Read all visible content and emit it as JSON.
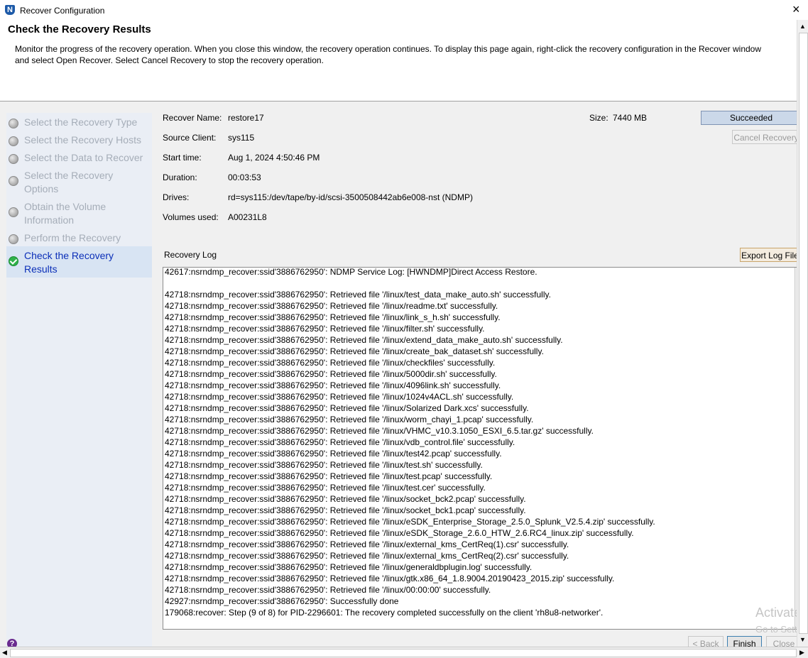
{
  "window": {
    "title": "Recover Configuration",
    "icon_letter": "N",
    "close_glyph": "×"
  },
  "header": {
    "heading": "Check the Recovery Results",
    "description": "Monitor the progress of the recovery operation. When you close this window, the recovery operation continues. To display this page again, right-click the recovery configuration in the Recover window and select Open Recover. Select Cancel Recovery to stop the recovery operation."
  },
  "steps": [
    {
      "label": "Select the Recovery Type",
      "state": "done"
    },
    {
      "label": "Select the Recovery Hosts",
      "state": "done"
    },
    {
      "label": "Select the Data to Recover",
      "state": "done"
    },
    {
      "label": "Select the Recovery Options",
      "state": "done"
    },
    {
      "label": "Obtain the Volume Information",
      "state": "done"
    },
    {
      "label": "Perform the Recovery",
      "state": "done"
    },
    {
      "label": "Check the Recovery Results",
      "state": "active"
    }
  ],
  "summary": {
    "recover_name_label": "Recover Name:",
    "recover_name": "restore17",
    "source_client_label": "Source Client:",
    "source_client": "sys115",
    "start_time_label": "Start time:",
    "start_time": "Aug 1, 2024 4:50:46 PM",
    "duration_label": "Duration:",
    "duration": "00:03:53",
    "drives_label": "Drives:",
    "drives": "rd=sys115:/dev/tape/by-id/scsi-3500508442ab6e008-nst (NDMP)",
    "volumes_label": "Volumes used:",
    "volumes": "A00231L8",
    "size_label": "Size:",
    "size": "7440 MB",
    "status": "Succeeded"
  },
  "buttons": {
    "cancel_recovery": "Cancel Recovery",
    "export_log": "Export Log File",
    "back": "< Back",
    "finish": "Finish",
    "close": "Close"
  },
  "log": {
    "label": "Recovery Log",
    "lines": [
      "42617:nsrndmp_recover:ssid'3886762950': NDMP Service Log: [HWNDMP]Direct Access Restore.",
      "",
      "42718:nsrndmp_recover:ssid'3886762950': Retrieved file '/linux/test_data_make_auto.sh' successfully.",
      "42718:nsrndmp_recover:ssid'3886762950': Retrieved file '/linux/readme.txt' successfully.",
      "42718:nsrndmp_recover:ssid'3886762950': Retrieved file '/linux/link_s_h.sh' successfully.",
      "42718:nsrndmp_recover:ssid'3886762950': Retrieved file '/linux/filter.sh' successfully.",
      "42718:nsrndmp_recover:ssid'3886762950': Retrieved file '/linux/extend_data_make_auto.sh' successfully.",
      "42718:nsrndmp_recover:ssid'3886762950': Retrieved file '/linux/create_bak_dataset.sh' successfully.",
      "42718:nsrndmp_recover:ssid'3886762950': Retrieved file '/linux/checkfiles' successfully.",
      "42718:nsrndmp_recover:ssid'3886762950': Retrieved file '/linux/5000dir.sh' successfully.",
      "42718:nsrndmp_recover:ssid'3886762950': Retrieved file '/linux/4096link.sh' successfully.",
      "42718:nsrndmp_recover:ssid'3886762950': Retrieved file '/linux/1024v4ACL.sh' successfully.",
      "42718:nsrndmp_recover:ssid'3886762950': Retrieved file '/linux/Solarized Dark.xcs' successfully.",
      "42718:nsrndmp_recover:ssid'3886762950': Retrieved file '/linux/worm_chayi_1.pcap' successfully.",
      "42718:nsrndmp_recover:ssid'3886762950': Retrieved file '/linux/VHMC_v10.3.1050_ESXI_6.5.tar.gz' successfully.",
      "42718:nsrndmp_recover:ssid'3886762950': Retrieved file '/linux/vdb_control.file' successfully.",
      "42718:nsrndmp_recover:ssid'3886762950': Retrieved file '/linux/test42.pcap' successfully.",
      "42718:nsrndmp_recover:ssid'3886762950': Retrieved file '/linux/test.sh' successfully.",
      "42718:nsrndmp_recover:ssid'3886762950': Retrieved file '/linux/test.pcap' successfully.",
      "42718:nsrndmp_recover:ssid'3886762950': Retrieved file '/linux/test.cer' successfully.",
      "42718:nsrndmp_recover:ssid'3886762950': Retrieved file '/linux/socket_bck2.pcap' successfully.",
      "42718:nsrndmp_recover:ssid'3886762950': Retrieved file '/linux/socket_bck1.pcap' successfully.",
      "42718:nsrndmp_recover:ssid'3886762950': Retrieved file '/linux/eSDK_Enterprise_Storage_2.5.0_Splunk_V2.5.4.zip' successfully.",
      "42718:nsrndmp_recover:ssid'3886762950': Retrieved file '/linux/eSDK_Storage_2.6.0_HTW_2.6.RC4_linux.zip' successfully.",
      "42718:nsrndmp_recover:ssid'3886762950': Retrieved file '/linux/external_kms_CertReq(1).csr' successfully.",
      "42718:nsrndmp_recover:ssid'3886762950': Retrieved file '/linux/external_kms_CertReq(2).csr' successfully.",
      "42718:nsrndmp_recover:ssid'3886762950': Retrieved file '/linux/generaldbplugin.log' successfully.",
      "42718:nsrndmp_recover:ssid'3886762950': Retrieved file '/linux/gtk.x86_64_1.8.9004.20190423_2015.zip' successfully.",
      "42718:nsrndmp_recover:ssid'3886762950': Retrieved file '/linux/00:00:00' successfully.",
      "42927:nsrndmp_recover:ssid'3886762950': Successfully done",
      "179068:recover: Step (9 of 8) for PID-2296601: The recovery completed successfully on the client 'rh8u8-networker'."
    ]
  },
  "watermark": {
    "line1": "Activate",
    "line2": "Go to Setti"
  },
  "help_glyph": "?"
}
